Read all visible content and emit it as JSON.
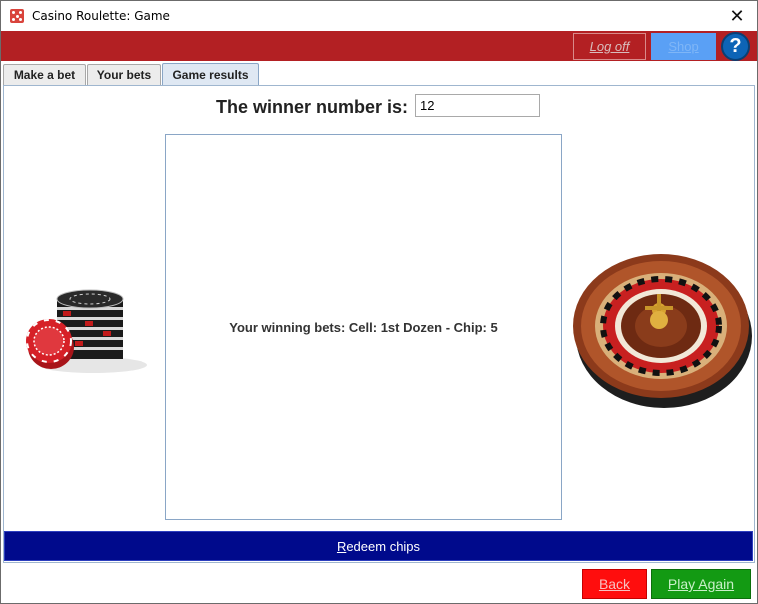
{
  "window": {
    "title": "Casino Roulette: Game",
    "close_symbol": "✕"
  },
  "header": {
    "logoff_label": "Log off",
    "shop_label": "Shop",
    "help_label": "?"
  },
  "tabs": [
    {
      "label": "Make a bet"
    },
    {
      "label": "Your bets"
    },
    {
      "label": "Game results"
    }
  ],
  "active_tab": "Game results",
  "results": {
    "winner_label": "The winner number is:",
    "winner_value": "12",
    "winning_bets_text": "Your winning bets: Cell: 1st Dozen - Chip: 5"
  },
  "footer": {
    "redeem_prefix": "R",
    "redeem_rest": "edeem chips",
    "back_label": "Back",
    "play_again_label": "Play Again"
  },
  "icons": {
    "app": "dice-icon",
    "chips": "casino-chips-icon",
    "wheel": "roulette-wheel-icon",
    "help": "help-icon"
  },
  "colors": {
    "header_red": "#b32023",
    "redeem_blue": "#000a8c",
    "back_red": "#ff0d0d",
    "play_green": "#139a13",
    "shop_blue": "#5aa0f5"
  }
}
